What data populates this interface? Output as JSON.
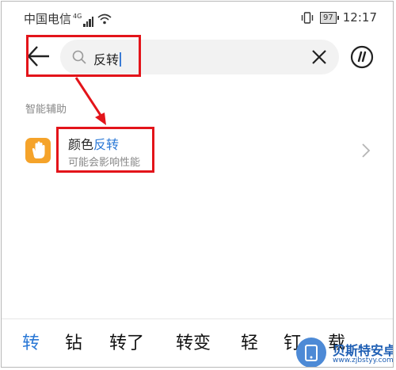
{
  "status_bar": {
    "carrier": "中国电信",
    "network": "4G",
    "battery": "97",
    "time": "12:17"
  },
  "search": {
    "value": "反转"
  },
  "section": {
    "label": "智能辅助"
  },
  "result": {
    "title_prefix": "颜色",
    "title_highlight": "反转",
    "subtitle": "可能会影响性能",
    "icon": "hand-icon",
    "icon_color": "#f5a32a",
    "highlight_color": "#2a78d6"
  },
  "candidates": [
    "转",
    "钻",
    "转了",
    "转变",
    "轻",
    "钉",
    "载"
  ],
  "watermark": {
    "title": "贝斯特安卓网",
    "url": "www.zjbstyy.com"
  },
  "annotation_color": "#e3141a"
}
